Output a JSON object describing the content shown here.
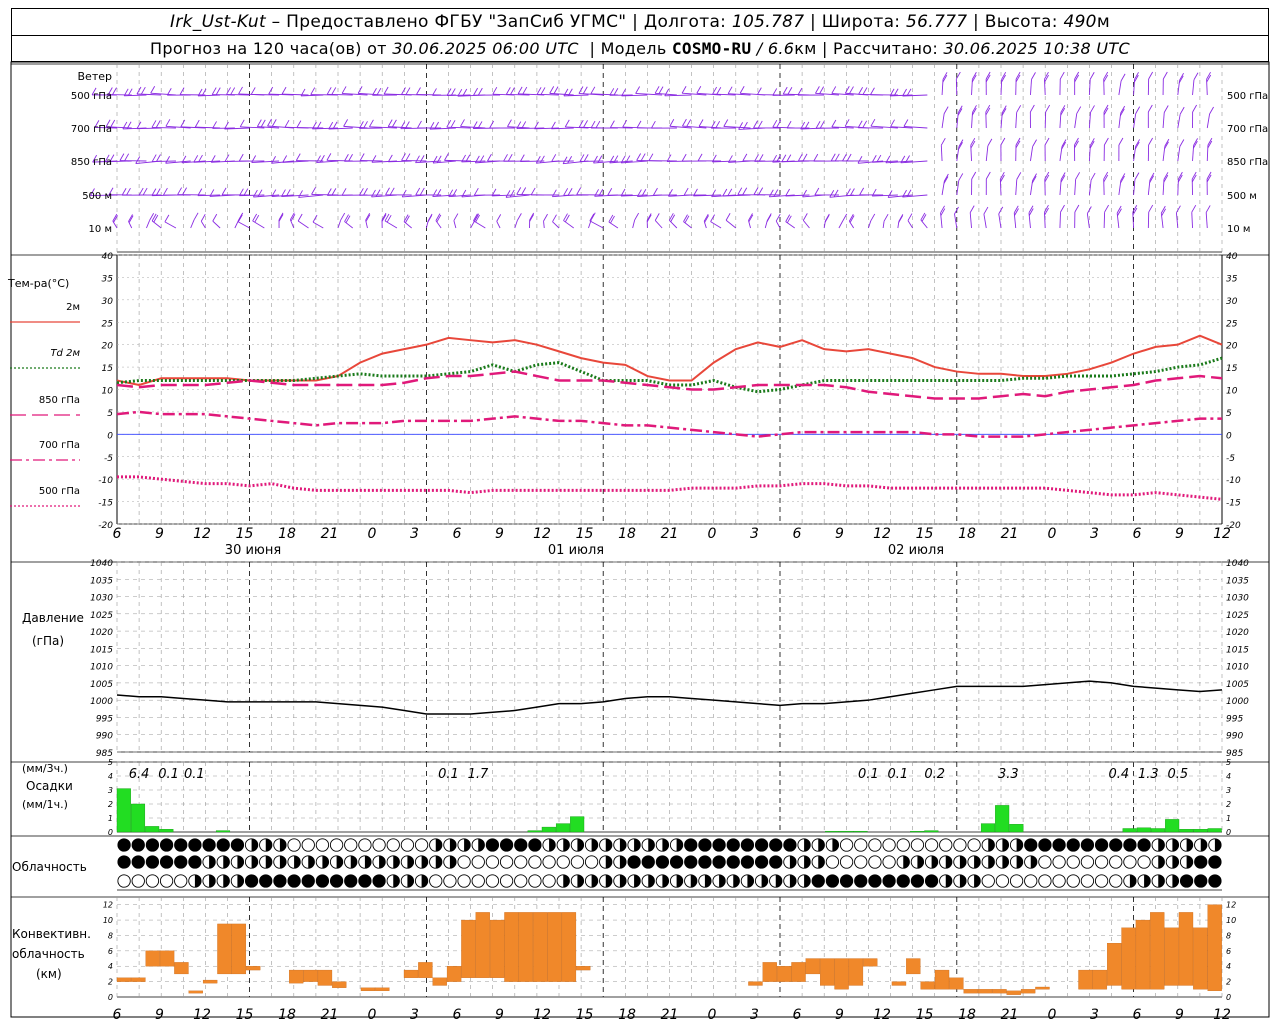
{
  "header": {
    "station": "Irk_Ust-Kut",
    "provider": " – Предоставлено ФГБУ \"ЗапСиб УГМС\" | Долгота: ",
    "lon": "105.787",
    "lat_label": " | Широта: ",
    "lat": "56.777",
    "alt_label": " | Высота: ",
    "alt": "490",
    "alt_unit": "м",
    "forecast_label": "Прогноз на 120 часа(ов) от ",
    "forecast_start": "30.06.2025 06:00 UTC",
    "model_label": "  | Модель ",
    "model": "COSMO-RU",
    "res": " / 6.6",
    "res_unit": "км",
    "calc_label": " | Рассчитано: ",
    "calc_time": "30.06.2025 10:38 UTC"
  },
  "axes": {
    "hour_ticks": [
      "6",
      "9",
      "12",
      "15",
      "18",
      "21",
      "0",
      "3",
      "6",
      "9",
      "12",
      "15",
      "18",
      "21",
      "0",
      "3",
      "6",
      "9",
      "12",
      "15",
      "18",
      "21",
      "0",
      "3",
      "6",
      "9",
      "12"
    ],
    "day_labels": [
      "30 июня",
      "01 июля",
      "02 июля"
    ]
  },
  "wind": {
    "title": "Ветер",
    "levels": [
      "500 гПа",
      "700 гПа",
      "850 гПа",
      "500  м",
      "10   м"
    ],
    "color": "#8a2be2"
  },
  "temperature": {
    "title": "Тем-ра(°С)",
    "legend": [
      {
        "label": "2м",
        "style": "solid",
        "color": "#e8473a"
      },
      {
        "label": "Td  2м",
        "style": "dotted",
        "color": "#1a7a1a"
      },
      {
        "label": "850 гПа",
        "style": "long-dash",
        "color": "#e0197a"
      },
      {
        "label": "700 гПа",
        "style": "dash-dot",
        "color": "#e0197a"
      },
      {
        "label": "500 гПа",
        "style": "dotted",
        "color": "#e0197a"
      }
    ],
    "yticks": [
      "40",
      "35",
      "30",
      "25",
      "20",
      "15",
      "10",
      "5",
      "0",
      "-5",
      "-10",
      "-15",
      "-20"
    ],
    "ylim": [
      -20,
      40
    ]
  },
  "pressure": {
    "title": "Давление",
    "unit": "(гПа)",
    "yticks": [
      "1040",
      "1035",
      "1030",
      "1025",
      "1020",
      "1015",
      "1010",
      "1005",
      "1000",
      "995",
      "990",
      "985"
    ],
    "ylim": [
      985,
      1040
    ]
  },
  "precip": {
    "title": "Осадки",
    "unit_top": "(мм/3ч.)",
    "unit_bottom": "(мм/1ч.)",
    "yticks": [
      "5",
      "4",
      "3",
      "2",
      "1",
      "0"
    ],
    "ylim": [
      0,
      5
    ],
    "totals": [
      {
        "h": 3,
        "v": "6.4"
      },
      {
        "h": 7,
        "v": "0.1"
      },
      {
        "h": 10.5,
        "v": "0.1"
      },
      {
        "h": 45,
        "v": "0.1"
      },
      {
        "h": 49,
        "v": "1.7"
      },
      {
        "h": 102,
        "v": "0.1"
      },
      {
        "h": 106,
        "v": "0.1"
      },
      {
        "h": 111,
        "v": "0.2"
      },
      {
        "h": 121,
        "v": "3.3"
      },
      {
        "h": 136,
        "v": "0.4"
      },
      {
        "h": 140,
        "v": "1.3"
      },
      {
        "h": 144,
        "v": "0.5"
      }
    ]
  },
  "cloud": {
    "title": "Облачность"
  },
  "convective": {
    "title1": "Конвективн.",
    "title2": "облачность",
    "unit": "(км)",
    "yticks": [
      "12",
      "10",
      "8",
      "6",
      "4",
      "2",
      "0"
    ],
    "ylim": [
      0,
      13
    ],
    "color": "#f0882a"
  },
  "chart_data": [
    {
      "type": "line",
      "title": "Тем-ра(°С)",
      "x_unit": "hours from 30.06.2025 06:00 UTC",
      "x": [
        0,
        3,
        6,
        9,
        12,
        15,
        18,
        21,
        24,
        27,
        30,
        33,
        36,
        39,
        42,
        45,
        48,
        51,
        54,
        57,
        60,
        63,
        66,
        69,
        72,
        75,
        78,
        81,
        84,
        87,
        90,
        93,
        96,
        99,
        102,
        105,
        108,
        111,
        114,
        117,
        120,
        123,
        126,
        129,
        132,
        135,
        138,
        141,
        144,
        147,
        150
      ],
      "ylim": [
        -20,
        40
      ],
      "series": [
        {
          "name": "2м",
          "values": [
            12,
            11,
            12.5,
            12.5,
            12.5,
            12.5,
            12,
            12,
            12,
            12,
            13,
            16,
            18,
            19,
            20,
            21.5,
            21,
            20.5,
            21,
            20,
            18.5,
            17,
            16,
            15.5,
            13,
            12,
            12,
            16,
            19,
            20.5,
            19.5,
            21,
            19,
            18.5,
            19,
            18,
            17,
            15,
            14,
            13.5,
            13.5,
            13,
            13,
            13.5,
            14.5,
            16,
            18,
            19.5,
            20,
            22,
            20
          ]
        },
        {
          "name": "Td  2м",
          "values": [
            11.5,
            12,
            12,
            12,
            12,
            12,
            12,
            12,
            12,
            12.5,
            13,
            13.5,
            13,
            13,
            13,
            13.5,
            14,
            15.5,
            14,
            15.5,
            16,
            14,
            12,
            12,
            12,
            11,
            11,
            12,
            10.5,
            9.5,
            10,
            11,
            12,
            12,
            12,
            12,
            12,
            12,
            12,
            12,
            12,
            12.5,
            12.5,
            13,
            13,
            13,
            13.5,
            14,
            15,
            15.5,
            17
          ]
        },
        {
          "name": "850 гПа",
          "values": [
            11,
            10.5,
            11,
            11,
            11,
            11.5,
            12,
            11.5,
            11,
            11,
            11,
            11,
            11,
            11.5,
            12.5,
            13,
            13,
            13.5,
            14,
            13,
            12,
            12,
            12,
            11.5,
            11,
            10.5,
            10,
            10,
            10.5,
            11,
            11,
            11,
            11,
            10.5,
            9.5,
            9,
            8.5,
            8,
            8,
            8,
            8.5,
            9,
            8.5,
            9.5,
            10,
            10.5,
            11,
            12,
            12.5,
            13,
            12.5
          ]
        },
        {
          "name": "700 гПа",
          "values": [
            4.5,
            5,
            4.5,
            4.5,
            4.5,
            4,
            3.5,
            3,
            2.5,
            2,
            2.5,
            2.5,
            2.5,
            3,
            3,
            3,
            3,
            3.5,
            4,
            3.5,
            3,
            3,
            2.5,
            2,
            2,
            1.5,
            1,
            0.5,
            0,
            -0.5,
            0,
            0.5,
            0.5,
            0.5,
            0.5,
            0.5,
            0.5,
            0,
            0,
            -0.5,
            -0.5,
            -0.5,
            0,
            0.5,
            1,
            1.5,
            2,
            2.5,
            3,
            3.5,
            3.5
          ]
        },
        {
          "name": "500 гПа",
          "values": [
            -9.5,
            -9.5,
            -10,
            -10.5,
            -11,
            -11,
            -11.5,
            -11,
            -12,
            -12.5,
            -12.5,
            -12.5,
            -12.5,
            -12.5,
            -12.5,
            -12.5,
            -13,
            -12.5,
            -12.5,
            -12.5,
            -12.5,
            -12.5,
            -12.5,
            -12.5,
            -12.5,
            -12.5,
            -12,
            -12,
            -12,
            -11.5,
            -11.5,
            -11,
            -11,
            -11.5,
            -11.5,
            -12,
            -12,
            -12,
            -12,
            -12,
            -12,
            -12,
            -12,
            -12.5,
            -13,
            -13.5,
            -13.5,
            -13,
            -13.5,
            -14,
            -14.5
          ]
        }
      ]
    },
    {
      "type": "line",
      "title": "Давление",
      "x_unit": "hours from 30.06.2025 06:00 UTC",
      "x": [
        0,
        3,
        6,
        9,
        12,
        15,
        18,
        21,
        24,
        27,
        30,
        33,
        36,
        39,
        42,
        45,
        48,
        51,
        54,
        57,
        60,
        63,
        66,
        69,
        72,
        75,
        78,
        81,
        84,
        87,
        90,
        93,
        96,
        99,
        102,
        105,
        108,
        111,
        114,
        117,
        120,
        123,
        126,
        129,
        132,
        135,
        138,
        141,
        144,
        147,
        150
      ],
      "ylim": [
        985,
        1040
      ],
      "series": [
        {
          "values": [
            1001.5,
            1001,
            1001,
            1000.5,
            1000,
            999.5,
            999.5,
            999.5,
            999.5,
            999.5,
            999,
            998.5,
            998,
            997,
            996,
            996,
            996,
            996.5,
            997,
            998,
            999,
            999,
            999.5,
            1000.5,
            1001,
            1001,
            1000.5,
            1000,
            999.5,
            999,
            998.5,
            999,
            999,
            999.5,
            1000,
            1001,
            1002,
            1003,
            1004,
            1004,
            1004,
            1004,
            1004.5,
            1005,
            1005.5,
            1005,
            1004,
            1003.5,
            1003,
            1002.5,
            1003
          ]
        }
      ]
    },
    {
      "type": "bar",
      "title": "Осадки",
      "x_unit": "hour index from 30.06.2025 06:00 UTC",
      "ylim": [
        0,
        5
      ],
      "bars": [
        {
          "h": 0,
          "v": 3.1
        },
        {
          "h": 1,
          "v": 2.0
        },
        {
          "h": 2,
          "v": 0.4
        },
        {
          "h": 3,
          "v": 0.2
        },
        {
          "h": 7,
          "v": 0.1
        },
        {
          "h": 29,
          "v": 0.1
        },
        {
          "h": 30,
          "v": 0.35
        },
        {
          "h": 31,
          "v": 0.6
        },
        {
          "h": 32,
          "v": 1.1
        },
        {
          "h": 50,
          "v": 0.05
        },
        {
          "h": 51,
          "v": 0.05
        },
        {
          "h": 52,
          "v": 0.05
        },
        {
          "h": 56,
          "v": 0.05
        },
        {
          "h": 57,
          "v": 0.1
        },
        {
          "h": 61,
          "v": 0.6
        },
        {
          "h": 62,
          "v": 1.9
        },
        {
          "h": 63,
          "v": 0.55
        },
        {
          "h": 71,
          "v": 0.25
        },
        {
          "h": 72,
          "v": 0.3
        },
        {
          "h": 73,
          "v": 0.25
        },
        {
          "h": 74,
          "v": 0.9
        },
        {
          "h": 75,
          "v": 0.2
        },
        {
          "h": 76,
          "v": 0.2
        },
        {
          "h": 77,
          "v": 0.25
        }
      ]
    },
    {
      "type": "bar",
      "title": "Конвективн. облачность",
      "x_unit": "hour index from 30.06.2025 06:00 UTC",
      "ylim": [
        0,
        13
      ],
      "bars": [
        {
          "h": 0,
          "b": 2,
          "t": 2.5
        },
        {
          "h": 1,
          "b": 2,
          "t": 2.5
        },
        {
          "h": 2,
          "b": 4,
          "t": 6
        },
        {
          "h": 3,
          "b": 4,
          "t": 6
        },
        {
          "h": 4,
          "b": 3,
          "t": 4.5
        },
        {
          "h": 5,
          "b": 0.5,
          "t": 0.8
        },
        {
          "h": 6,
          "b": 1.8,
          "t": 2.2
        },
        {
          "h": 7,
          "b": 3,
          "t": 9.5
        },
        {
          "h": 8,
          "b": 3,
          "t": 9.5
        },
        {
          "h": 9,
          "b": 3.5,
          "t": 4
        },
        {
          "h": 12,
          "b": 1.8,
          "t": 3.5
        },
        {
          "h": 13,
          "b": 2,
          "t": 3.5
        },
        {
          "h": 14,
          "b": 1.5,
          "t": 3.5
        },
        {
          "h": 15,
          "b": 1.2,
          "t": 2
        },
        {
          "h": 17,
          "b": 0.8,
          "t": 1.2
        },
        {
          "h": 18,
          "b": 0.8,
          "t": 1.2
        },
        {
          "h": 20,
          "b": 2.5,
          "t": 3.5
        },
        {
          "h": 21,
          "b": 2.5,
          "t": 4.5
        },
        {
          "h": 22,
          "b": 1.5,
          "t": 2.5
        },
        {
          "h": 23,
          "b": 2,
          "t": 4
        },
        {
          "h": 24,
          "b": 2.5,
          "t": 10
        },
        {
          "h": 25,
          "b": 2.5,
          "t": 11
        },
        {
          "h": 26,
          "b": 2.5,
          "t": 10
        },
        {
          "h": 27,
          "b": 2,
          "t": 11
        },
        {
          "h": 28,
          "b": 2,
          "t": 11
        },
        {
          "h": 29,
          "b": 2,
          "t": 11
        },
        {
          "h": 30,
          "b": 2,
          "t": 11
        },
        {
          "h": 31,
          "b": 2,
          "t": 11
        },
        {
          "h": 32,
          "b": 3.5,
          "t": 4
        },
        {
          "h": 44,
          "b": 1.5,
          "t": 2
        },
        {
          "h": 45,
          "b": 2,
          "t": 4.5
        },
        {
          "h": 46,
          "b": 2,
          "t": 4
        },
        {
          "h": 47,
          "b": 2,
          "t": 4.5
        },
        {
          "h": 48,
          "b": 3,
          "t": 5
        },
        {
          "h": 49,
          "b": 1.5,
          "t": 5
        },
        {
          "h": 50,
          "b": 1,
          "t": 5
        },
        {
          "h": 51,
          "b": 1.5,
          "t": 5
        },
        {
          "h": 52,
          "b": 4,
          "t": 5
        },
        {
          "h": 54,
          "b": 1.5,
          "t": 2
        },
        {
          "h": 55,
          "b": 3,
          "t": 5
        },
        {
          "h": 56,
          "b": 1,
          "t": 2
        },
        {
          "h": 57,
          "b": 1,
          "t": 3.5
        },
        {
          "h": 58,
          "b": 1,
          "t": 2.5
        },
        {
          "h": 59,
          "b": 0.5,
          "t": 1
        },
        {
          "h": 60,
          "b": 0.5,
          "t": 1
        },
        {
          "h": 61,
          "b": 0.5,
          "t": 1
        },
        {
          "h": 62,
          "b": 0.3,
          "t": 0.8
        },
        {
          "h": 63,
          "b": 0.5,
          "t": 1
        },
        {
          "h": 64,
          "b": 1,
          "t": 1.3
        },
        {
          "h": 67,
          "b": 1,
          "t": 3.5
        },
        {
          "h": 68,
          "b": 1,
          "t": 3.5
        },
        {
          "h": 69,
          "b": 1.5,
          "t": 7
        },
        {
          "h": 70,
          "b": 1,
          "t": 9
        },
        {
          "h": 71,
          "b": 1,
          "t": 10
        },
        {
          "h": 72,
          "b": 1,
          "t": 11
        },
        {
          "h": 73,
          "b": 1.5,
          "t": 9
        },
        {
          "h": 74,
          "b": 1.5,
          "t": 11
        },
        {
          "h": 75,
          "b": 1,
          "t": 9
        },
        {
          "h": 76,
          "b": 0.8,
          "t": 12
        }
      ]
    }
  ]
}
